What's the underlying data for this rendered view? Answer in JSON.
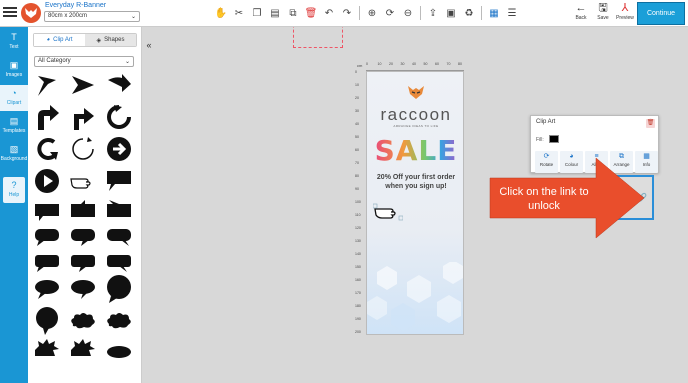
{
  "header": {
    "project_title": "Everyday R-Banner",
    "size_value": "80cm x 200cm",
    "right_buttons": {
      "back": "Back",
      "save": "Save",
      "preview": "Preview"
    },
    "continue_label": "Continue"
  },
  "rail": {
    "text": "Text",
    "images": "Images",
    "clipart": "Clipart",
    "templates": "Templates",
    "background": "Background",
    "help": "Help"
  },
  "panel": {
    "tab_clipart": "Clip Art",
    "tab_shapes": "Shapes",
    "category_value": "All Category"
  },
  "canvas": {
    "ruler_unit": "cm",
    "top_ticks": [
      "0",
      "10",
      "20",
      "30",
      "40",
      "50",
      "60",
      "70",
      "80"
    ],
    "left_ticks": [
      "0",
      "10",
      "20",
      "30",
      "40",
      "50",
      "60",
      "70",
      "80",
      "90",
      "100",
      "110",
      "120",
      "130",
      "140",
      "150",
      "160",
      "170",
      "180",
      "190",
      "200"
    ],
    "brand_name": "raccoon",
    "tagline": "ARRANGE IDEAS TO LIFE",
    "sale_text": "SALE",
    "offer_text": "20% Off your first order when you sign up!"
  },
  "props": {
    "title": "Clip Art",
    "fill_label": "Fill:",
    "fill_color": "#000000",
    "buttons": [
      "Rotate",
      "Colour",
      "Align",
      "Arrange",
      "Info"
    ]
  },
  "callout": {
    "text": "Click on the link to unlock",
    "color": "#e94e2c"
  },
  "colors": {
    "accent": "#1a96d4",
    "brand_orange": "#e4532d"
  }
}
